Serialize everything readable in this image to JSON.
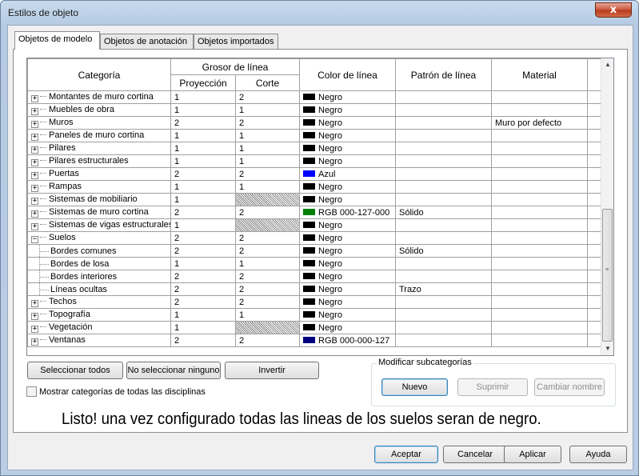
{
  "window": {
    "title": "Estilos de objeto",
    "close_label": "x"
  },
  "tabs": [
    {
      "label": "Objetos de modelo",
      "active": true
    },
    {
      "label": "Objetos de anotación",
      "active": false
    },
    {
      "label": "Objetos importados",
      "active": false
    }
  ],
  "grid": {
    "headers": {
      "categoria": "Categoría",
      "grosor": "Grosor de línea",
      "proyeccion": "Proyección",
      "corte": "Corte",
      "color": "Color de línea",
      "patron": "Patrón de línea",
      "material": "Material"
    },
    "rows": [
      {
        "name": "Montantes de muro cortina",
        "level": 0,
        "expander": "+",
        "proj": "1",
        "cut": "2",
        "cut_hatched": false,
        "color_name": "Negro",
        "color": "#000000",
        "pattern": "",
        "material": ""
      },
      {
        "name": "Muebles de obra",
        "level": 0,
        "expander": "+",
        "proj": "1",
        "cut": "1",
        "cut_hatched": false,
        "color_name": "Negro",
        "color": "#000000",
        "pattern": "",
        "material": ""
      },
      {
        "name": "Muros",
        "level": 0,
        "expander": "+",
        "proj": "2",
        "cut": "2",
        "cut_hatched": false,
        "color_name": "Negro",
        "color": "#000000",
        "pattern": "",
        "material": "Muro por defecto"
      },
      {
        "name": "Paneles de muro cortina",
        "level": 0,
        "expander": "+",
        "proj": "1",
        "cut": "1",
        "cut_hatched": false,
        "color_name": "Negro",
        "color": "#000000",
        "pattern": "",
        "material": ""
      },
      {
        "name": "Pilares",
        "level": 0,
        "expander": "+",
        "proj": "1",
        "cut": "1",
        "cut_hatched": false,
        "color_name": "Negro",
        "color": "#000000",
        "pattern": "",
        "material": ""
      },
      {
        "name": "Pilares estructurales",
        "level": 0,
        "expander": "+",
        "proj": "1",
        "cut": "1",
        "cut_hatched": false,
        "color_name": "Negro",
        "color": "#000000",
        "pattern": "",
        "material": ""
      },
      {
        "name": "Puertas",
        "level": 0,
        "expander": "+",
        "proj": "2",
        "cut": "2",
        "cut_hatched": false,
        "color_name": "Azul",
        "color": "#0000ff",
        "pattern": "",
        "material": ""
      },
      {
        "name": "Rampas",
        "level": 0,
        "expander": "+",
        "proj": "1",
        "cut": "1",
        "cut_hatched": false,
        "color_name": "Negro",
        "color": "#000000",
        "pattern": "",
        "material": ""
      },
      {
        "name": "Sistemas de mobiliario",
        "level": 0,
        "expander": "+",
        "proj": "1",
        "cut": "",
        "cut_hatched": true,
        "color_name": "Negro",
        "color": "#000000",
        "pattern": "",
        "material": ""
      },
      {
        "name": "Sistemas de muro cortina",
        "level": 0,
        "expander": "+",
        "proj": "2",
        "cut": "2",
        "cut_hatched": false,
        "color_name": "RGB 000-127-000",
        "color": "#007f00",
        "pattern": "Sólido",
        "material": ""
      },
      {
        "name": "Sistemas de vigas estructurales",
        "level": 0,
        "expander": "+",
        "proj": "1",
        "cut": "",
        "cut_hatched": true,
        "color_name": "Negro",
        "color": "#000000",
        "pattern": "",
        "material": ""
      },
      {
        "name": "Suelos",
        "level": 0,
        "expander": "−",
        "proj": "2",
        "cut": "2",
        "cut_hatched": false,
        "color_name": "Negro",
        "color": "#000000",
        "pattern": "",
        "material": ""
      },
      {
        "name": "Bordes comunes",
        "level": 1,
        "expander": "",
        "proj": "2",
        "cut": "2",
        "cut_hatched": false,
        "color_name": "Negro",
        "color": "#000000",
        "pattern": "Sólido",
        "material": ""
      },
      {
        "name": "Bordes de losa",
        "level": 1,
        "expander": "",
        "proj": "1",
        "cut": "1",
        "cut_hatched": false,
        "color_name": "Negro",
        "color": "#000000",
        "pattern": "",
        "material": ""
      },
      {
        "name": "Bordes interiores",
        "level": 1,
        "expander": "",
        "proj": "2",
        "cut": "2",
        "cut_hatched": false,
        "color_name": "Negro",
        "color": "#000000",
        "pattern": "",
        "material": ""
      },
      {
        "name": "Líneas ocultas",
        "level": 1,
        "expander": "",
        "proj": "2",
        "cut": "2",
        "cut_hatched": false,
        "color_name": "Negro",
        "color": "#000000",
        "pattern": "Trazo",
        "material": ""
      },
      {
        "name": "Techos",
        "level": 0,
        "expander": "+",
        "proj": "2",
        "cut": "2",
        "cut_hatched": false,
        "color_name": "Negro",
        "color": "#000000",
        "pattern": "",
        "material": ""
      },
      {
        "name": "Topografía",
        "level": 0,
        "expander": "+",
        "proj": "1",
        "cut": "1",
        "cut_hatched": false,
        "color_name": "Negro",
        "color": "#000000",
        "pattern": "",
        "material": ""
      },
      {
        "name": "Vegetación",
        "level": 0,
        "expander": "+",
        "proj": "1",
        "cut": "",
        "cut_hatched": true,
        "color_name": "Negro",
        "color": "#000000",
        "pattern": "",
        "material": ""
      },
      {
        "name": "Ventanas",
        "level": 0,
        "expander": "+",
        "proj": "2",
        "cut": "2",
        "cut_hatched": false,
        "color_name": "RGB 000-000-127",
        "color": "#00007f",
        "pattern": "",
        "material": ""
      }
    ]
  },
  "selection_buttons": {
    "select_all": "Seleccionar todos",
    "select_none": "No seleccionar ninguno",
    "invert": "Invertir"
  },
  "show_all_disciplines": {
    "label": "Mostrar categorías de todas las disciplinas",
    "checked": false
  },
  "subcategories": {
    "title": "Modificar subcategorías",
    "new": "Nuevo",
    "delete": "Suprimir",
    "rename": "Cambiar nombre"
  },
  "annotation": "Listo! una vez configurado todas las lineas de los suelos seran de negro.",
  "footer": {
    "ok": "Aceptar",
    "cancel": "Cancelar",
    "apply": "Aplicar",
    "help": "Ayuda"
  }
}
